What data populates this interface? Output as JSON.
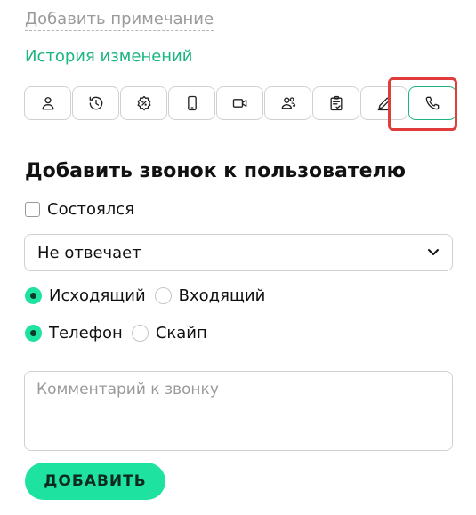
{
  "links": {
    "add_note": "Добавить примечание",
    "history": "История изменений"
  },
  "toolbar": {
    "icons": [
      "user-icon",
      "history-clock-icon",
      "settings-gear-icon",
      "mobile-phone-icon",
      "video-camera-icon",
      "users-group-icon",
      "clipboard-check-icon",
      "pencil-icon",
      "phone-icon"
    ],
    "active_index": 8
  },
  "form": {
    "title": "Добавить звонок к пользователю",
    "happened_label": "Состоялся",
    "status_value": "Не отвечает",
    "direction": {
      "outgoing": "Исходящий",
      "incoming": "Входящий",
      "selected": "outgoing"
    },
    "channel": {
      "phone": "Телефон",
      "skype": "Скайп",
      "selected": "phone"
    },
    "comment_placeholder": "Комментарий к звонку",
    "submit_label": "ДОБАВИТЬ"
  },
  "colors": {
    "accent": "#1ee3a0",
    "link_green": "#1db57f",
    "highlight_red": "#e03c3c"
  }
}
